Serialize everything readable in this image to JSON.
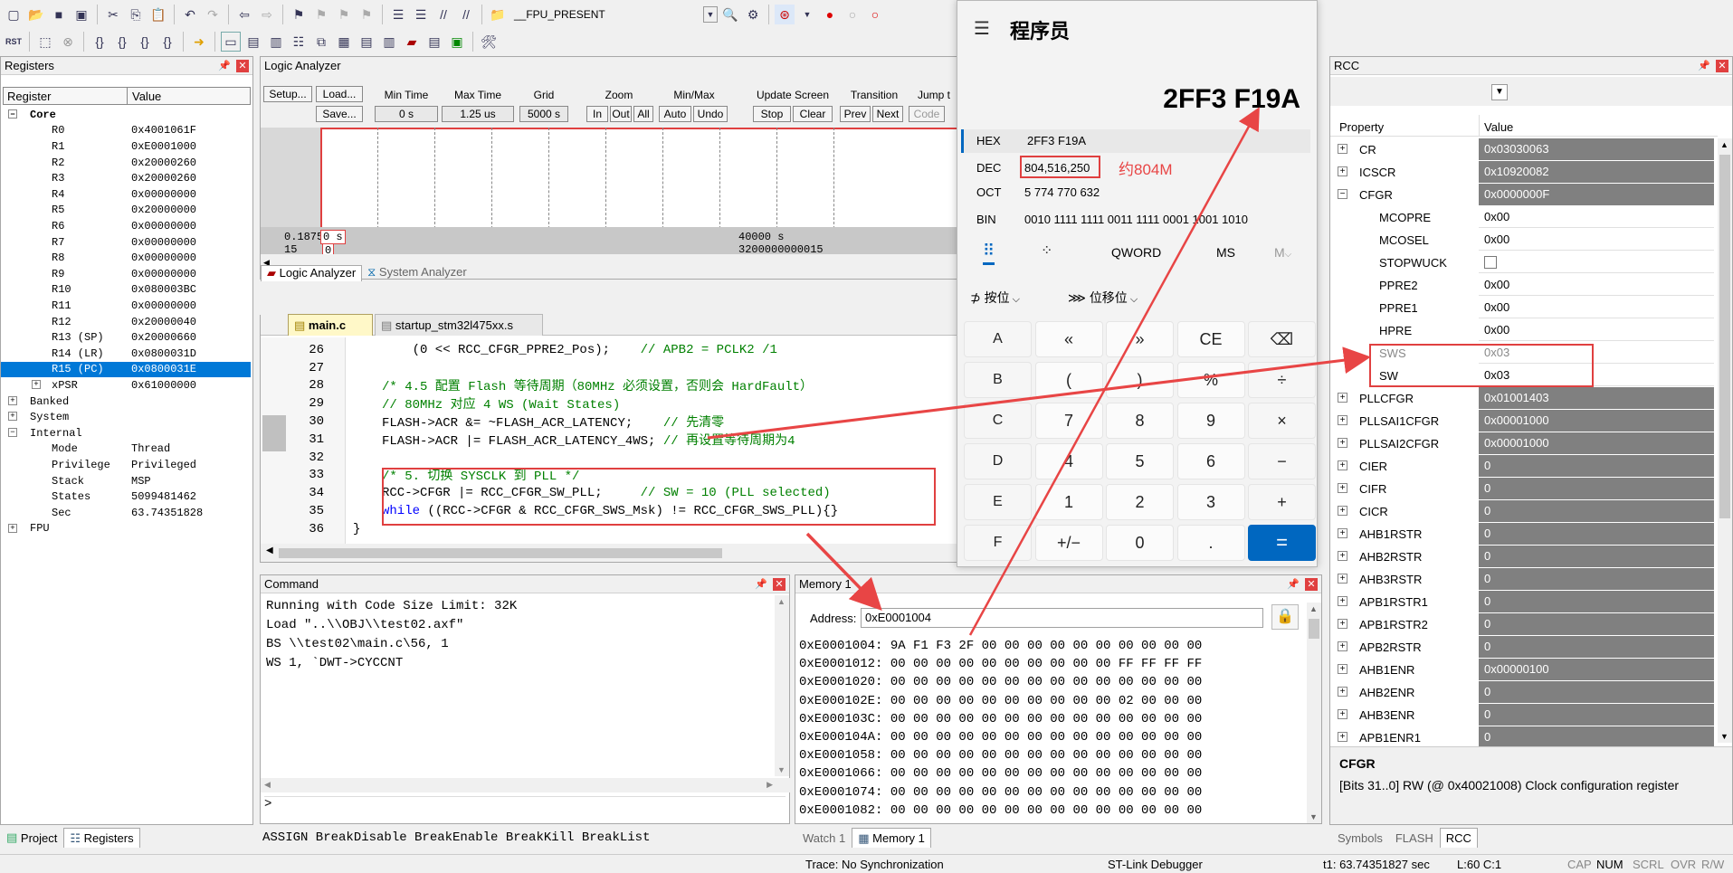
{
  "toolbar": {
    "target_combo": "__FPU_PRESENT"
  },
  "registers_panel": {
    "title": "Registers",
    "col_register": "Register",
    "col_value": "Value",
    "core_label": "Core",
    "rows": [
      {
        "name": "R0",
        "value": "0x4001061F"
      },
      {
        "name": "R1",
        "value": "0xE0001000"
      },
      {
        "name": "R2",
        "value": "0x20000260"
      },
      {
        "name": "R3",
        "value": "0x20000260"
      },
      {
        "name": "R4",
        "value": "0x00000000"
      },
      {
        "name": "R5",
        "value": "0x20000000"
      },
      {
        "name": "R6",
        "value": "0x00000000"
      },
      {
        "name": "R7",
        "value": "0x00000000"
      },
      {
        "name": "R8",
        "value": "0x00000000"
      },
      {
        "name": "R9",
        "value": "0x00000000"
      },
      {
        "name": "R10",
        "value": "0x080003BC"
      },
      {
        "name": "R11",
        "value": "0x00000000"
      },
      {
        "name": "R12",
        "value": "0x20000040"
      },
      {
        "name": "R13 (SP)",
        "value": "0x20000660"
      },
      {
        "name": "R14 (LR)",
        "value": "0x0800031D"
      },
      {
        "name": "R15 (PC)",
        "value": "0x0800031E"
      },
      {
        "name": "xPSR",
        "value": "0x61000000"
      }
    ],
    "groups": [
      "Banked",
      "System",
      "Internal"
    ],
    "internal_rows": [
      {
        "name": "Mode",
        "value": "Thread"
      },
      {
        "name": "Privilege",
        "value": "Privileged"
      },
      {
        "name": "Stack",
        "value": "MSP"
      },
      {
        "name": "States",
        "value": "5099481462"
      },
      {
        "name": "Sec",
        "value": "63.74351828"
      }
    ],
    "fpu_label": "FPU",
    "tabs": [
      "Project",
      "Registers"
    ]
  },
  "logic_analyzer": {
    "title": "Logic Analyzer",
    "setup": "Setup...",
    "load": "Load...",
    "save": "Save...",
    "min_time_label": "Min Time",
    "min_time_value": "0 s",
    "max_time_label": "Max Time",
    "max_time_value": "1.25 us",
    "grid_label": "Grid",
    "grid_value": "5000 s",
    "zoom_label": "Zoom",
    "zoom_in": "In",
    "zoom_out": "Out",
    "zoom_all": "All",
    "minmax_label": "Min/Max",
    "auto": "Auto",
    "undo": "Undo",
    "update_label": "Update Screen",
    "stop": "Stop",
    "clear": "Clear",
    "transition_label": "Transition",
    "prev": "Prev",
    "next": "Next",
    "jump_label": "Jump t",
    "code": "Code",
    "left_time": "0.1875",
    "left_cursor": "0 s",
    "left_row2": "15",
    "left_cursor2": "0",
    "mid_time": "40000  s",
    "mid_val": "3200000000015",
    "tab1": "Logic Analyzer",
    "tab2": "System Analyzer"
  },
  "editor": {
    "tab_active": "main.c",
    "tab_other": "startup_stm32l475xx.s",
    "lines": [
      {
        "n": "26",
        "segs": [
          {
            "t": "    (0 << RCC_CFGR_PPRE2_Pos);    ",
            "c": ""
          },
          {
            "t": "// APB2 = PCLK2 /1",
            "c": "cmt"
          }
        ]
      },
      {
        "n": "27",
        "segs": []
      },
      {
        "n": "28",
        "segs": [
          {
            "t": "/* 4.5 配置 Flash 等待周期（80MHz 必须设置，否则会 HardFault）",
            "c": "cmt"
          }
        ]
      },
      {
        "n": "29",
        "segs": [
          {
            "t": "// 80MHz 对应 4 WS (Wait States)",
            "c": "cmt"
          }
        ]
      },
      {
        "n": "30",
        "segs": [
          {
            "t": "FLASH->ACR &= ~FLASH_ACR_LATENCY;    ",
            "c": ""
          },
          {
            "t": "// 先清零",
            "c": "cmt"
          }
        ]
      },
      {
        "n": "31",
        "segs": [
          {
            "t": "FLASH->ACR |= FLASH_ACR_LATENCY_4WS; ",
            "c": ""
          },
          {
            "t": "// 再设置等待周期为4",
            "c": "cmt"
          }
        ]
      },
      {
        "n": "32",
        "segs": []
      },
      {
        "n": "33",
        "segs": [
          {
            "t": "/* 5. 切换 SYSCLK 到 PLL */",
            "c": "cmt"
          }
        ]
      },
      {
        "n": "34",
        "segs": [
          {
            "t": "RCC->CFGR |= RCC_CFGR_SW_PLL;     ",
            "c": ""
          },
          {
            "t": "// SW = 10 (PLL selected)",
            "c": "cmt"
          }
        ]
      },
      {
        "n": "35",
        "segs": [
          {
            "t": "while",
            "c": "kw"
          },
          {
            "t": " ((RCC->CFGR & RCC_CFGR_SWS_Msk) != RCC_CFGR_SWS_PLL){}",
            "c": ""
          }
        ]
      },
      {
        "n": "36",
        "segs": [
          {
            "t": "}",
            "c": "",
            "indent": "back"
          }
        ]
      }
    ]
  },
  "command": {
    "title": "Command",
    "lines": [
      "Running with Code Size Limit: 32K",
      "Load \"..\\\\OBJ\\\\test02.axf\"",
      "BS \\\\test02\\main.c\\56, 1",
      "WS 1, `DWT->CYCCNT"
    ],
    "prompt": ">",
    "hints": "ASSIGN BreakDisable BreakEnable BreakKill BreakList"
  },
  "memory": {
    "title": "Memory 1",
    "address_label": "Address:",
    "address_value": "0xE0001004",
    "rows": [
      "0xE0001004: 9A F1 F3 2F 00 00 00 00 00 00 00 00 00 00",
      "0xE0001012: 00 00 00 00 00 00 00 00 00 00 FF FF FF FF",
      "0xE0001020: 00 00 00 00 00 00 00 00 00 00 00 00 00 00",
      "0xE000102E: 00 00 00 00 00 00 00 00 00 00 02 00 00 00",
      "0xE000103C: 00 00 00 00 00 00 00 00 00 00 00 00 00 00",
      "0xE000104A: 00 00 00 00 00 00 00 00 00 00 00 00 00 00",
      "0xE0001058: 00 00 00 00 00 00 00 00 00 00 00 00 00 00",
      "0xE0001066: 00 00 00 00 00 00 00 00 00 00 00 00 00 00",
      "0xE0001074: 00 00 00 00 00 00 00 00 00 00 00 00 00 00",
      "0xE0001082: 00 00 00 00 00 00 00 00 00 00 00 00 00 00"
    ],
    "tabs": [
      "Watch 1",
      "Memory 1"
    ]
  },
  "calculator": {
    "mode_title": "程序员",
    "display": "2FF3 F19A",
    "hex_label": "HEX",
    "hex_value": "2FF3 F19A",
    "dec_label": "DEC",
    "dec_value": "804,516,250",
    "annotation": "约804M",
    "oct_label": "OCT",
    "oct_value": "5 774 770 632",
    "bin_label": "BIN",
    "bin_value": "0010 1111 1111 0011 1111 0001 1001 1010",
    "word_size": "QWORD",
    "ms": "MS",
    "mv": "M",
    "bitwise": "按位",
    "shift": "位移位",
    "keys": [
      "A",
      "«",
      "»",
      "CE",
      "⌫",
      "B",
      "(",
      ")",
      "%",
      "÷",
      "C",
      "7",
      "8",
      "9",
      "×",
      "D",
      "4",
      "5",
      "6",
      "−",
      "E",
      "1",
      "2",
      "3",
      "+",
      "F",
      "+/−",
      "0",
      ".",
      "="
    ]
  },
  "rcc": {
    "title": "RCC",
    "col_property": "Property",
    "col_value": "Value",
    "rows": [
      {
        "name": "CR",
        "value": "0x03030063",
        "type": "reg"
      },
      {
        "name": "ICSCR",
        "value": "0x10920082",
        "type": "reg"
      },
      {
        "name": "CFGR",
        "value": "0x0000000F",
        "type": "reg-open"
      },
      {
        "name": "MCOPRE",
        "value": "0x00",
        "type": "field"
      },
      {
        "name": "MCOSEL",
        "value": "0x00",
        "type": "field"
      },
      {
        "name": "STOPWUCK",
        "value": "",
        "type": "check"
      },
      {
        "name": "PPRE2",
        "value": "0x00",
        "type": "field"
      },
      {
        "name": "PPRE1",
        "value": "0x00",
        "type": "field"
      },
      {
        "name": "HPRE",
        "value": "0x00",
        "type": "field"
      },
      {
        "name": "SWS",
        "value": "0x03",
        "type": "field-ro"
      },
      {
        "name": "SW",
        "value": "0x03",
        "type": "field"
      },
      {
        "name": "PLLCFGR",
        "value": "0x01001403",
        "type": "reg"
      },
      {
        "name": "PLLSAI1CFGR",
        "value": "0x00001000",
        "type": "reg"
      },
      {
        "name": "PLLSAI2CFGR",
        "value": "0x00001000",
        "type": "reg"
      },
      {
        "name": "CIER",
        "value": "0",
        "type": "reg"
      },
      {
        "name": "CIFR",
        "value": "0",
        "type": "reg"
      },
      {
        "name": "CICR",
        "value": "0",
        "type": "reg"
      },
      {
        "name": "AHB1RSTR",
        "value": "0",
        "type": "reg"
      },
      {
        "name": "AHB2RSTR",
        "value": "0",
        "type": "reg"
      },
      {
        "name": "AHB3RSTR",
        "value": "0",
        "type": "reg"
      },
      {
        "name": "APB1RSTR1",
        "value": "0",
        "type": "reg"
      },
      {
        "name": "APB1RSTR2",
        "value": "0",
        "type": "reg"
      },
      {
        "name": "APB2RSTR",
        "value": "0",
        "type": "reg"
      },
      {
        "name": "AHB1ENR",
        "value": "0x00000100",
        "type": "reg"
      },
      {
        "name": "AHB2ENR",
        "value": "0",
        "type": "reg"
      },
      {
        "name": "AHB3ENR",
        "value": "0",
        "type": "reg"
      },
      {
        "name": "APB1ENR1",
        "value": "0",
        "type": "reg"
      }
    ],
    "desc_title": "CFGR",
    "desc_text": "[Bits 31..0] RW (@ 0x40021008) Clock configuration register",
    "tabs": [
      "Symbols",
      "FLASH",
      "RCC"
    ]
  },
  "status": {
    "trace": "Trace: No Synchronization",
    "debugger": "ST-Link Debugger",
    "time": "t1: 63.74351827 sec",
    "pos": "L:60 C:1",
    "caps": "CAP",
    "num": "NUM",
    "scrl": "SCRL",
    "ovr": "OVR",
    "rw": "R/W"
  },
  "colors": {
    "annotation_red": "#e84545",
    "selection_blue": "#0078d7",
    "calc_equals": "#0067c0"
  }
}
